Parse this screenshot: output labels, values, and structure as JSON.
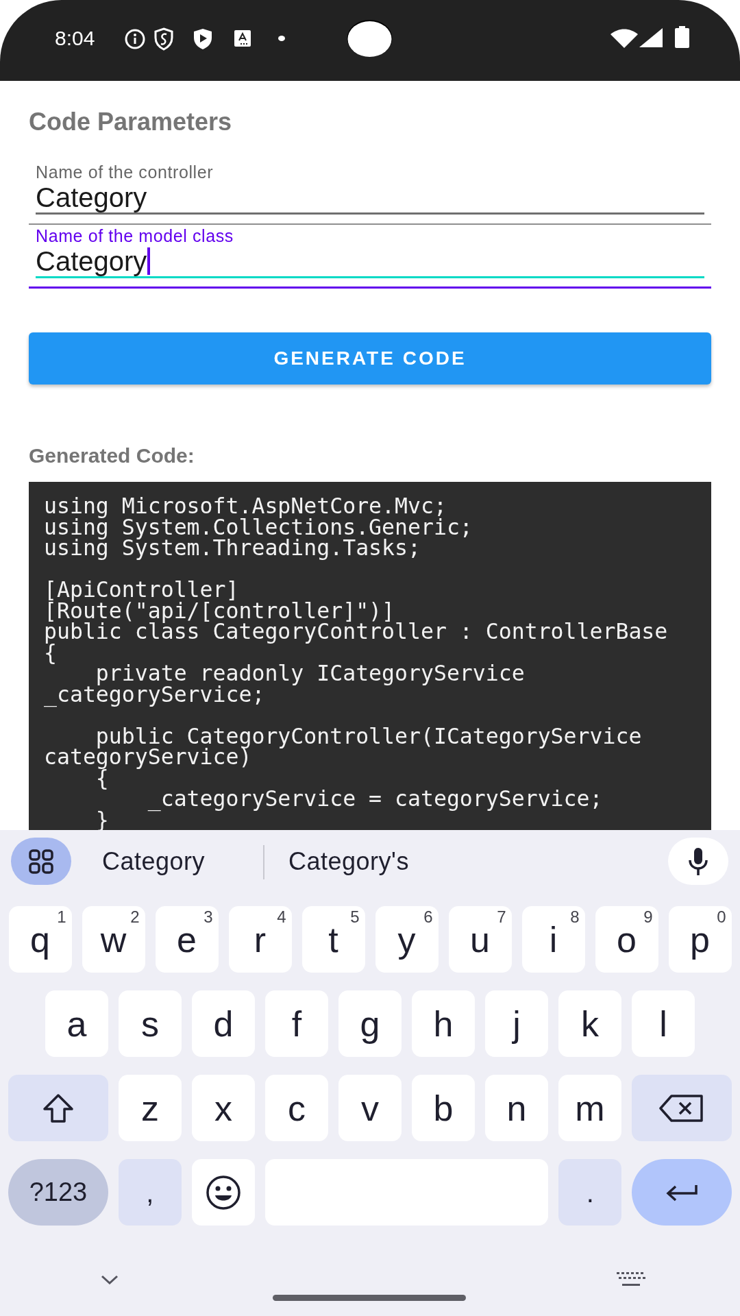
{
  "status_bar": {
    "time": "8:04"
  },
  "title": "Code Parameters",
  "fields": [
    {
      "label": "Name of the controller",
      "value": "Category",
      "focused": false
    },
    {
      "label": "Name of the model class",
      "value": "Category",
      "focused": true
    }
  ],
  "generate_button": "GENERATE CODE",
  "output_heading": "Generated Code:",
  "code": "using Microsoft.AspNetCore.Mvc;\nusing System.Collections.Generic;\nusing System.Threading.Tasks;\n\n[ApiController]\n[Route(\"api/[controller]\")]\npublic class CategoryController : ControllerBase\n{\n    private readonly ICategoryService\n_categoryService;\n\n    public CategoryController(ICategoryService\ncategoryService)\n    {\n        _categoryService = categoryService;\n    }",
  "keyboard": {
    "suggestions": [
      "Category",
      "Category's"
    ],
    "top_row": [
      {
        "kind": "letter",
        "label": "q",
        "hint": "1"
      },
      {
        "kind": "letter",
        "label": "w",
        "hint": "2"
      },
      {
        "kind": "letter",
        "label": "e",
        "hint": "3"
      },
      {
        "kind": "letter",
        "label": "r",
        "hint": "4"
      },
      {
        "kind": "letter",
        "label": "t",
        "hint": "5"
      },
      {
        "kind": "letter",
        "label": "y",
        "hint": "6"
      },
      {
        "kind": "letter",
        "label": "u",
        "hint": "7"
      },
      {
        "kind": "letter",
        "label": "i",
        "hint": "8"
      },
      {
        "kind": "letter",
        "label": "o",
        "hint": "9"
      },
      {
        "kind": "letter",
        "label": "p",
        "hint": "0"
      }
    ],
    "home_row": [
      {
        "kind": "letter",
        "label": "a"
      },
      {
        "kind": "letter",
        "label": "s"
      },
      {
        "kind": "letter",
        "label": "d"
      },
      {
        "kind": "letter",
        "label": "f"
      },
      {
        "kind": "letter",
        "label": "g"
      },
      {
        "kind": "letter",
        "label": "h"
      },
      {
        "kind": "letter",
        "label": "j"
      },
      {
        "kind": "letter",
        "label": "k"
      },
      {
        "kind": "letter",
        "label": "l"
      }
    ],
    "bottom_row": [
      {
        "kind": "shift"
      },
      {
        "kind": "letter",
        "label": "z"
      },
      {
        "kind": "letter",
        "label": "x"
      },
      {
        "kind": "letter",
        "label": "c"
      },
      {
        "kind": "letter",
        "label": "v"
      },
      {
        "kind": "letter",
        "label": "b"
      },
      {
        "kind": "letter",
        "label": "n"
      },
      {
        "kind": "letter",
        "label": "m"
      },
      {
        "kind": "backspace"
      }
    ],
    "action_row": [
      {
        "kind": "symbols",
        "label": "?123"
      },
      {
        "kind": "punct",
        "label": ","
      },
      {
        "kind": "emoji"
      },
      {
        "kind": "space"
      },
      {
        "kind": "punct",
        "label": "."
      },
      {
        "kind": "enter"
      }
    ]
  }
}
